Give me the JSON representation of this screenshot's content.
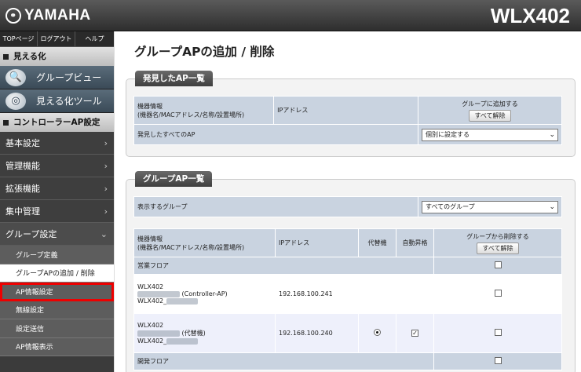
{
  "header": {
    "brand": "YAMAHA",
    "model": "WLX402"
  },
  "topnav": [
    "TOPページ",
    "ログアウト",
    "ヘルプ"
  ],
  "sidebar": {
    "visual_section": "見える化",
    "tools": [
      {
        "label": "グループビュー",
        "icon": "magnifier-icon"
      },
      {
        "label": "見える化ツール",
        "icon": "globe-magnifier-icon"
      }
    ],
    "controller_section": "コントローラーAP設定",
    "menus": [
      "基本設定",
      "管理機能",
      "拡張機能",
      "集中管理",
      "グループ設定"
    ],
    "submenus": [
      "グループ定義",
      "グループAPの追加 / 削除",
      "AP情報設定",
      "無線設定",
      "設定送信",
      "AP情報表示"
    ]
  },
  "page_title": "グループAPの追加 / 削除",
  "found": {
    "tab": "発見したAP一覧",
    "col_info_1": "機器情報",
    "col_info_2": "(機器名/MACアドレス/名称/設置場所)",
    "col_ip": "IPアドレス",
    "col_add": "グループに追加する",
    "btn_all_clear": "すべて解除",
    "all_row_label": "発見したすべてのAP",
    "all_row_select": "個別に設定する"
  },
  "group": {
    "tab": "グループAP一覧",
    "show_label": "表示するグループ",
    "show_select": "すべてのグループ",
    "col_info_1": "機器情報",
    "col_info_2": "(機器名/MACアドレス/名称/設置場所)",
    "col_ip": "IPアドレス",
    "col_sub": "代替機",
    "col_auto": "自動昇格",
    "col_del": "グループから削除する",
    "btn_all_clear": "すべて解除",
    "floors": [
      "営業フロア",
      "開発フロア"
    ],
    "rows": [
      {
        "line1": "WLX402",
        "line2_suffix": "(Controller-AP)",
        "line3": "WLX402_",
        "ip": "192.168.100.241",
        "sub": false,
        "auto": false
      },
      {
        "line1": "WLX402",
        "line2_suffix": "(代替機)",
        "line3": "WLX402_",
        "ip": "192.168.100.240",
        "sub": true,
        "auto": true
      }
    ]
  }
}
